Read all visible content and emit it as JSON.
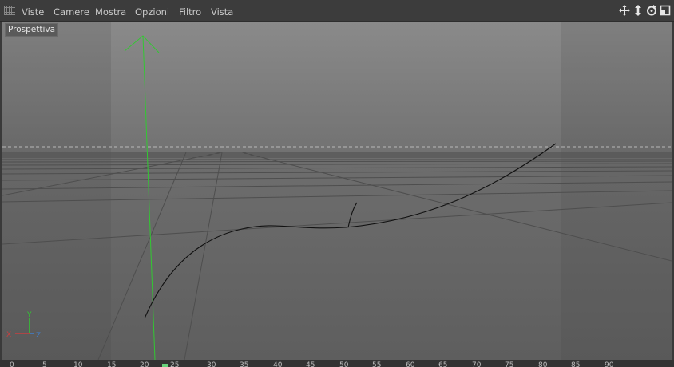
{
  "menubar": {
    "items": [
      "Viste",
      "Camere",
      "Mostra",
      "Opzioni",
      "Filtro",
      "Vista"
    ],
    "tools": [
      "move-icon",
      "dolly-icon",
      "rotate-icon",
      "maximize-icon"
    ]
  },
  "viewport": {
    "label": "Prospettiva",
    "axes": {
      "y": "Y",
      "x": "X",
      "z": "Z"
    }
  },
  "timeline": {
    "ticks": [
      "0",
      "5",
      "10",
      "15",
      "20",
      "25",
      "30",
      "35",
      "40",
      "45",
      "50",
      "55",
      "60",
      "65",
      "70",
      "75",
      "80",
      "85",
      "90"
    ],
    "current_frame": 25
  },
  "colors": {
    "viewport_bg": "#7a7a7a",
    "grid_line": "#4a4a4a",
    "y_axis": "#32c832",
    "x_axis": "#c84040",
    "z_axis": "#4080d0",
    "spline": "#111111"
  }
}
